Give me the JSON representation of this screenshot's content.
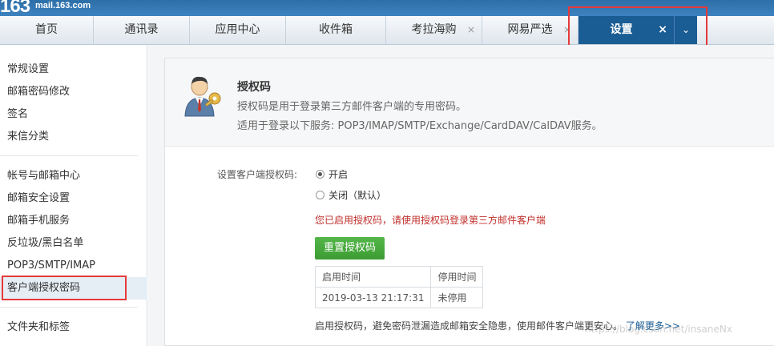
{
  "brand": {
    "logo_number": "163",
    "domain": "mail.163.com"
  },
  "tabs": [
    {
      "label": "首页"
    },
    {
      "label": "通讯录"
    },
    {
      "label": "应用中心"
    },
    {
      "label": "收件箱"
    },
    {
      "label": "考拉海购",
      "close": "×"
    },
    {
      "label": "网易严选",
      "close": "×"
    },
    {
      "label": "设置",
      "close": "×",
      "active": true
    }
  ],
  "tab_more": "⌄",
  "sidebar": {
    "groups": [
      [
        "常规设置",
        "邮箱密码修改",
        "签名",
        "来信分类"
      ],
      [
        "帐号与邮箱中心",
        "邮箱安全设置",
        "邮箱手机服务",
        "反垃圾/黑白名单",
        "POP3/SMTP/IMAP",
        "客户端授权密码"
      ],
      [
        "文件夹和标签"
      ]
    ],
    "selected": "客户端授权密码"
  },
  "panel": {
    "title": "授权码",
    "desc1": "授权码是用于登录第三方邮件客户端的专用密码。",
    "desc2": "适用于登录以下服务: POP3/IMAP/SMTP/Exchange/CardDAV/CalDAV服务。",
    "setting_label": "设置客户端授权码:",
    "option_on": "开启",
    "option_off": "关闭（默认）",
    "selected_option": "开启",
    "warning": "您已启用授权码，请使用授权码登录第三方邮件客户端",
    "reset_button": "重置授权码",
    "table": {
      "headers": [
        "启用时间",
        "停用时间"
      ],
      "row": [
        "2019-03-13 21:17:31",
        "未停用"
      ]
    },
    "tip": "启用授权码，避免密码泄漏造成邮箱安全隐患，使用邮件客户端更安心。",
    "tip_link": "了解更多>>"
  },
  "watermark": "https://blog.csdn.net/insaneNx",
  "colors": {
    "active_tab": "#1a5c94",
    "warning": "#c0302b",
    "button": "#48a93e",
    "highlight": "#e53a3a"
  }
}
